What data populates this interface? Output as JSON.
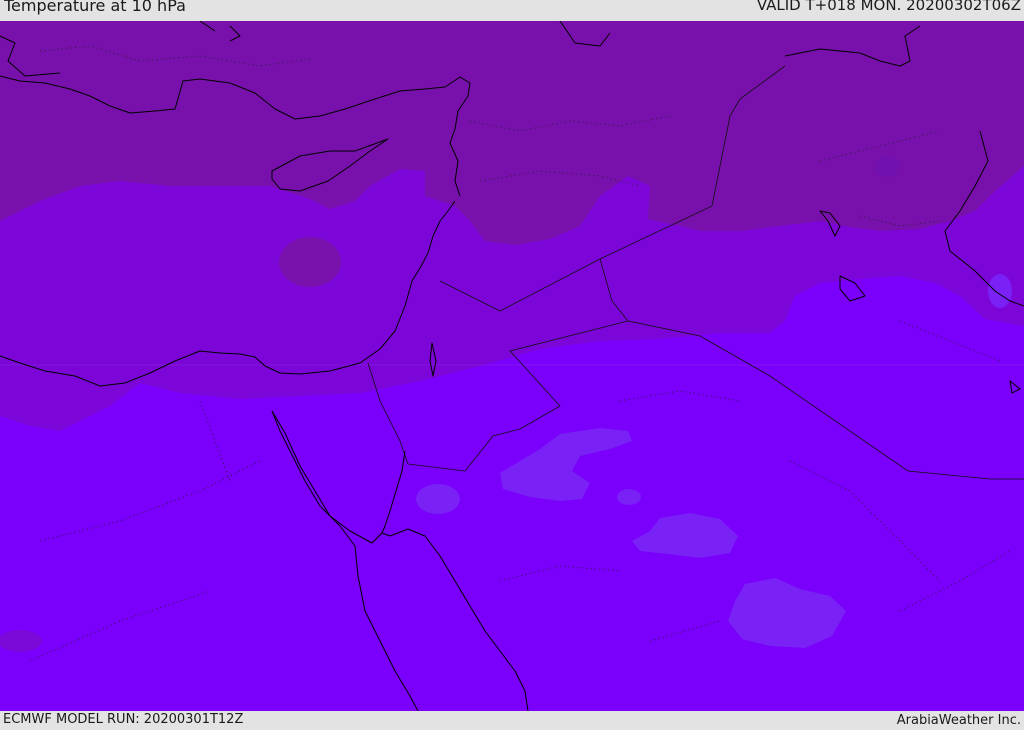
{
  "header": {
    "title": "Temperature at 10 hPa",
    "valid_time": "VALID T+018 MON. 20200302T06Z"
  },
  "footer": {
    "model_run": "ECMWF MODEL RUN: 20200301T12Z",
    "credit": "ArabiaWeather Inc."
  },
  "map": {
    "field_colors": {
      "north_band": "#7811ab",
      "middle_band": "#7c06d8",
      "south_band": "#7b00fb",
      "cold_patches": "#7a21f6",
      "warm_patches": "#7c15c1"
    }
  }
}
